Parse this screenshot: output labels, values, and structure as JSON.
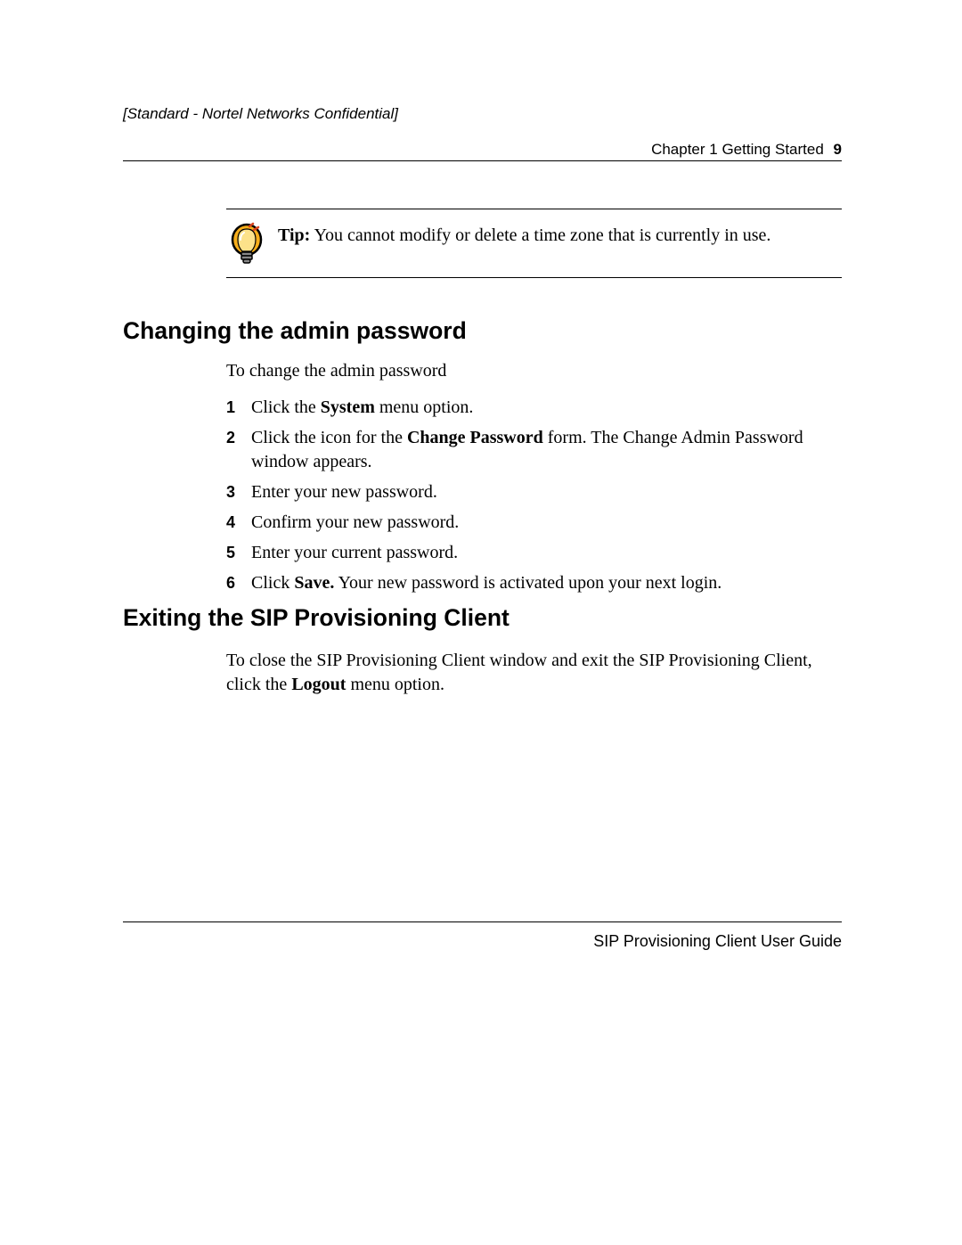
{
  "header": {
    "confidential": "[Standard - Nortel Networks Confidential]",
    "chapter": "Chapter 1  Getting Started",
    "page_number": "9"
  },
  "tip": {
    "label": "Tip:",
    "text": "You cannot modify or delete a time zone that is currently in use."
  },
  "section1": {
    "heading": "Changing the admin password",
    "intro": "To change the admin password",
    "steps": [
      {
        "pre": "Click the ",
        "bold": "System",
        "post": " menu option."
      },
      {
        "pre": "Click the icon for the ",
        "bold": "Change Password",
        "post": " form. The Change Admin Password window appears."
      },
      {
        "pre": "Enter your new password.",
        "bold": "",
        "post": ""
      },
      {
        "pre": "Confirm your new password.",
        "bold": "",
        "post": ""
      },
      {
        "pre": "Enter your current password.",
        "bold": "",
        "post": ""
      },
      {
        "pre": "Click ",
        "bold": "Save.",
        "post": " Your new password is activated upon your next login."
      }
    ]
  },
  "section2": {
    "heading": "Exiting the SIP Provisioning Client",
    "para_pre": "To close the SIP Provisioning Client window and exit the SIP Provisioning Client, click the ",
    "para_bold": "Logout",
    "para_post": " menu option."
  },
  "footer": {
    "text": "SIP Provisioning Client User Guide"
  }
}
